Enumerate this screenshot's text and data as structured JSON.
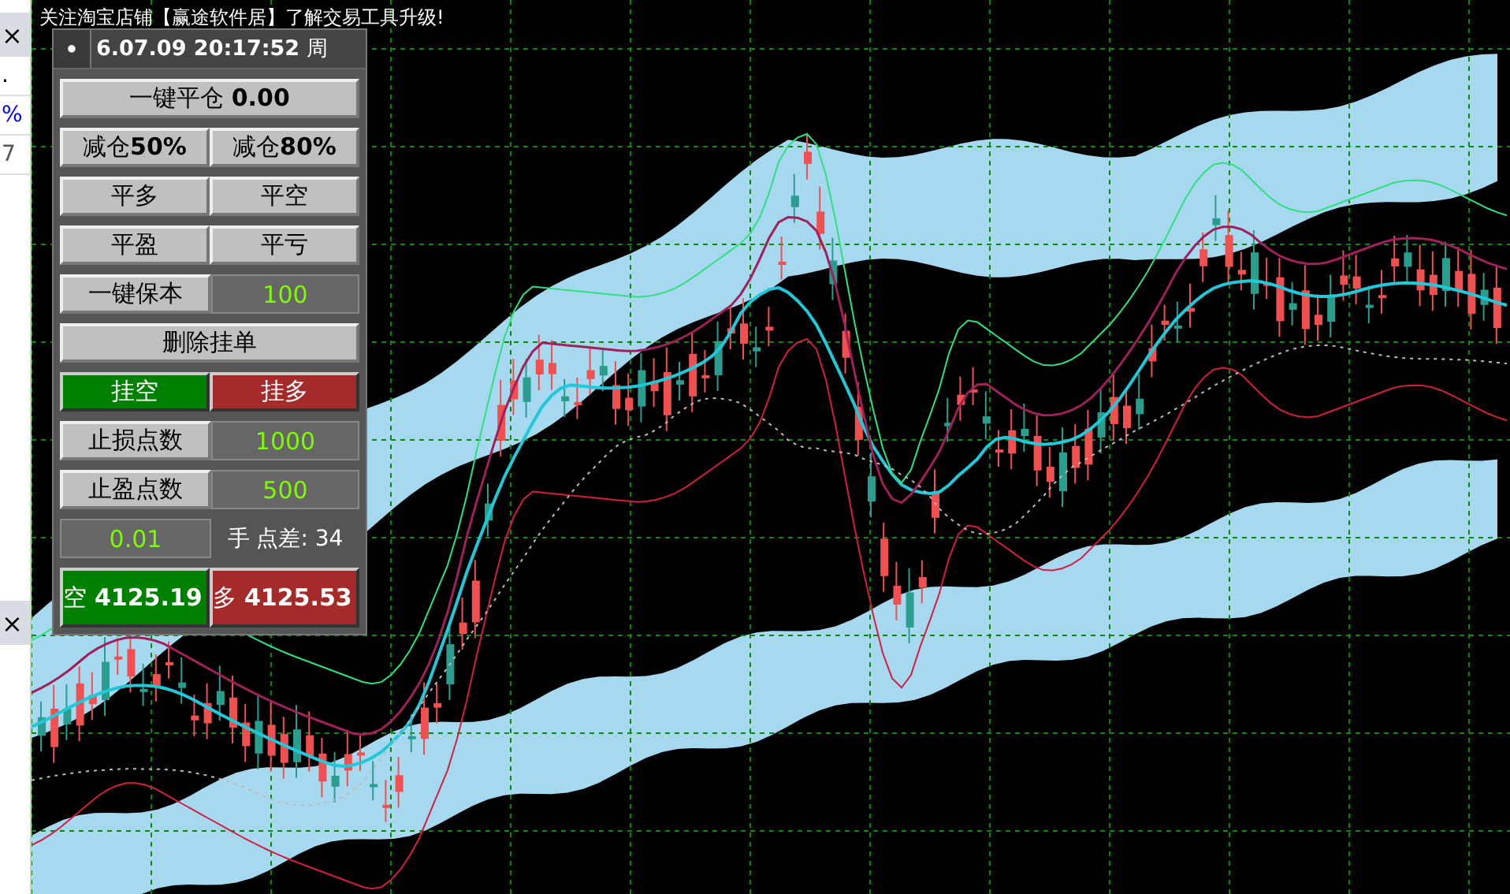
{
  "side_strip": {
    "top_close": "×",
    "texts": [
      {
        "text": ".",
        "color": "#000000"
      },
      {
        "text": "%",
        "color": "#0000ff"
      },
      {
        "text": "7",
        "color": "#555555"
      }
    ],
    "bottom_close": "×"
  },
  "chart": {
    "notice": "关注淘宝店铺【赢途软件居】了解交易工具升级!"
  },
  "panel": {
    "header": {
      "dot": "●",
      "time": "**6.07.09 20:17:52** 周"
    },
    "rows": [
      [
        {
          "kind": "button",
          "text": "一键平仓 **0.00**"
        }
      ],
      [
        {
          "kind": "button",
          "text": "减仓**50%**"
        },
        {
          "kind": "button",
          "text": "减仓**80%**"
        }
      ],
      [
        {
          "kind": "button",
          "text": "平多"
        },
        {
          "kind": "button",
          "text": "平空"
        }
      ],
      [
        {
          "kind": "button",
          "text": "平盈"
        },
        {
          "kind": "button",
          "text": "平亏"
        }
      ],
      [
        {
          "kind": "button",
          "text": "一键保本"
        },
        {
          "kind": "field",
          "text": "100"
        }
      ],
      [
        {
          "kind": "button",
          "text": "删除挂单"
        }
      ],
      [
        {
          "kind": "order",
          "text": "挂空",
          "color": "#008000"
        },
        {
          "kind": "order",
          "text": "挂多",
          "color": "#a52a2a"
        }
      ],
      [
        {
          "kind": "button",
          "text": "止损点数"
        },
        {
          "kind": "field",
          "text": "1000"
        }
      ],
      [
        {
          "kind": "button",
          "text": "止盈点数"
        },
        {
          "kind": "field",
          "text": "500"
        }
      ],
      [
        {
          "kind": "field",
          "text": "0.01"
        },
        {
          "kind": "label",
          "text": "手 点差: 34"
        }
      ],
      [
        {
          "kind": "quote",
          "label": "空",
          "text": "4125.19",
          "color": "#008000"
        },
        {
          "kind": "quote",
          "label": "多",
          "text": "4125.53",
          "color": "#a52a2a"
        }
      ]
    ]
  }
}
